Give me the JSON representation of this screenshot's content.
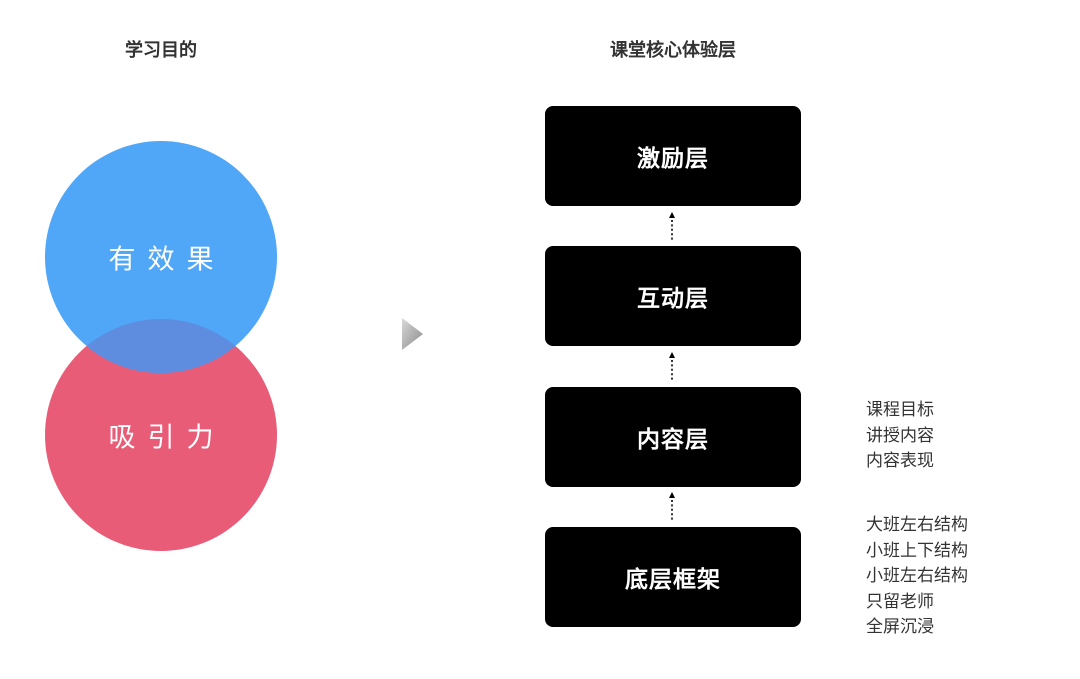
{
  "headings": {
    "left": "学习目的",
    "right": "课堂核心体验层"
  },
  "venn": {
    "top_label": "有效果",
    "bottom_label": "吸引力",
    "top_color": "#50A7F7",
    "bottom_color": "#E85C77",
    "overlap_color": "#5E8DE0"
  },
  "layers": [
    {
      "label": "激励层"
    },
    {
      "label": "互动层"
    },
    {
      "label": "内容层"
    },
    {
      "label": "底层框架"
    }
  ],
  "notes": {
    "content": [
      "课程目标",
      "讲授内容",
      "内容表现"
    ],
    "framework": [
      "大班左右结构",
      "小班上下结构",
      "小班左右结构",
      "只留老师",
      "全屏沉浸"
    ]
  },
  "colors": {
    "box": "#000000",
    "text_dark": "#333333"
  }
}
